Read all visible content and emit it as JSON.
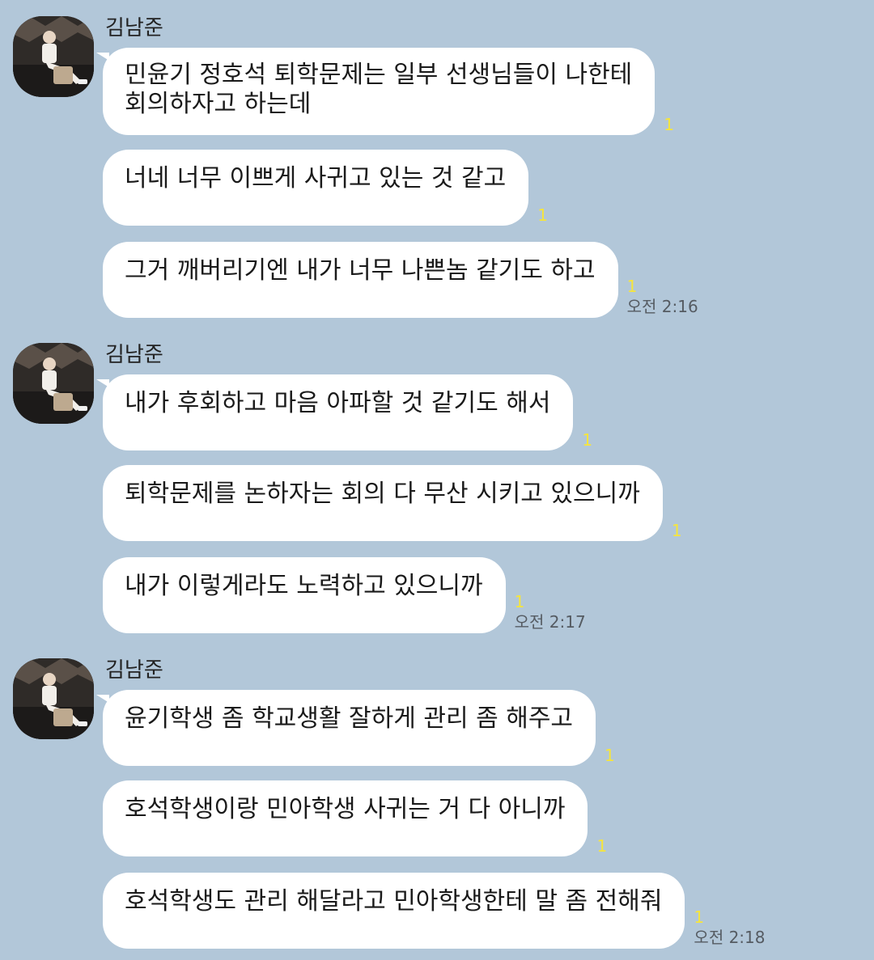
{
  "colors": {
    "background": "#b2c7d9",
    "bubble": "#ffffff",
    "unread": "#f6e53c"
  },
  "groups": [
    {
      "sender": "김남준",
      "messages": [
        {
          "lines": [
            "민윤기 정호석 퇴학문제는 일부 선생님들이 나한테",
            "회의하자고 하는데"
          ],
          "unread": "1",
          "time": ""
        },
        {
          "lines": [
            "너네 너무 이쁘게 사귀고 있는 것 같고"
          ],
          "unread": "1",
          "time": ""
        },
        {
          "lines": [
            "그거 깨버리기엔 내가 너무 나쁜놈 같기도 하고"
          ],
          "unread": "1",
          "time": "오전 2:16"
        }
      ]
    },
    {
      "sender": "김남준",
      "messages": [
        {
          "lines": [
            "내가 후회하고 마음 아파할 것 같기도 해서"
          ],
          "unread": "1",
          "time": ""
        },
        {
          "lines": [
            "퇴학문제를 논하자는 회의 다 무산 시키고 있으니까"
          ],
          "unread": "1",
          "time": ""
        },
        {
          "lines": [
            "내가 이렇게라도 노력하고 있으니까"
          ],
          "unread": "1",
          "time": "오전 2:17"
        }
      ]
    },
    {
      "sender": "김남준",
      "messages": [
        {
          "lines": [
            "윤기학생 좀 학교생활 잘하게 관리 좀 해주고"
          ],
          "unread": "1",
          "time": ""
        },
        {
          "lines": [
            "호석학생이랑 민아학생 사귀는 거 다 아니까"
          ],
          "unread": "1",
          "time": ""
        },
        {
          "lines": [
            "호석학생도 관리 해달라고 민아학생한테 말 좀 전해줘"
          ],
          "unread": "1",
          "time": "오전 2:18"
        }
      ]
    }
  ]
}
